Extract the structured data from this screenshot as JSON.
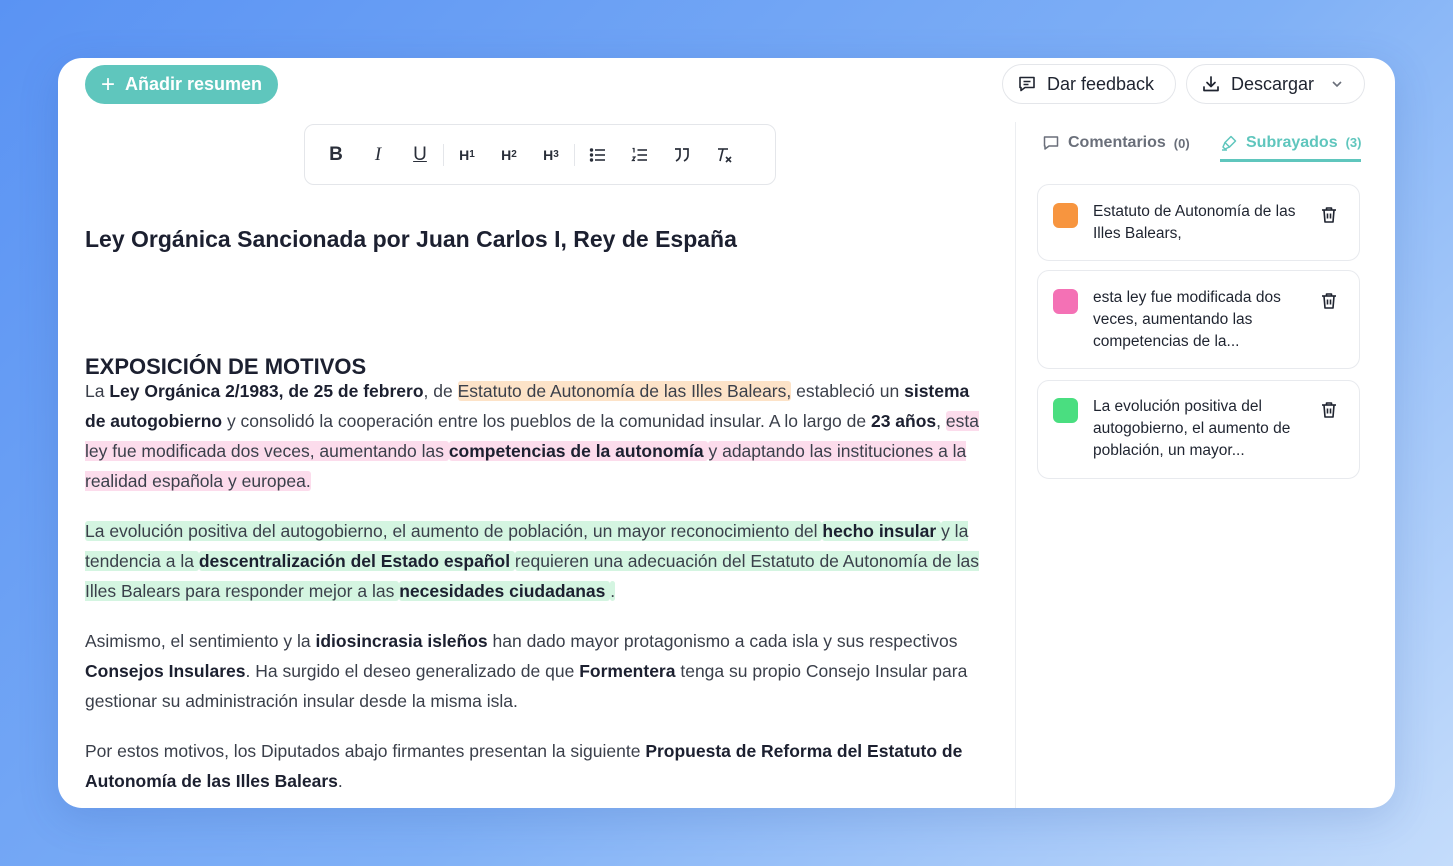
{
  "header": {
    "add_summary_label": "Añadir resumen",
    "feedback_label": "Dar feedback",
    "download_label": "Descargar"
  },
  "toolbar": {
    "bold": "B",
    "italic": "I",
    "underline": "U",
    "h1": "H",
    "h2": "H",
    "h3": "H",
    "h1_num": "1",
    "h2_num": "2",
    "h3_num": "3"
  },
  "document": {
    "title": "Ley Orgánica Sancionada por Juan Carlos I, Rey de España",
    "section_title": "EXPOSICIÓN DE MOTIVOS",
    "p1": {
      "t1": "La ",
      "b1": "Ley Orgánica 2/1983, de 25 de febrero",
      "t2": ", de ",
      "h1": "Estatuto de Autonomía de las Illes Balears,",
      "t3": " estableció un ",
      "b2": "sistema de autogobierno",
      "t4": " y consolidó la cooperación entre los pueblos de la comunidad insular. A lo largo de ",
      "b3": "23 años",
      "t5": ", ",
      "h2a": " esta ley fue modificada dos veces, aumentando las ",
      "h2b": " competencias de la autonomía ",
      "h2c": " y adaptando las instituciones a la realidad española y europea."
    },
    "p2": {
      "h1": " La evolución positiva del autogobierno, el aumento de población, un mayor reconocimiento del ",
      "b1": " hecho insular ",
      "h2": " y la tendencia a la ",
      "b2": " descentralización del Estado español ",
      "h3": " requieren una adecuación del Estatuto de Autonomía de las Illes Balears para responder mejor a las ",
      "b3": " necesidades ciudadanas ",
      "h4": "."
    },
    "p3": {
      "t1": "Asimismo, el sentimiento y la ",
      "b1": "idiosincrasia isleños",
      "t2": " han dado mayor protagonismo a cada isla y sus respectivos ",
      "b2": "Consejos Insulares",
      "t3": ". Ha surgido el deseo generalizado de que ",
      "b3": "Formentera",
      "t4": " tenga su propio Consejo Insular para gestionar su administración insular desde la misma isla."
    },
    "p4": {
      "t1": "Por estos motivos, los Diputados abajo firmantes presentan la siguiente ",
      "b1": "Propuesta de Reforma del Estatuto de Autonomía de las Illes Balears",
      "t2": "."
    }
  },
  "sidebar": {
    "tabs": [
      {
        "label": "Comentarios",
        "count": "(0)"
      },
      {
        "label": "Subrayados",
        "count": "(3)"
      }
    ],
    "highlights": [
      {
        "text": "Estatuto de Autonomía de las Illes Balears,",
        "color": "#f7953f"
      },
      {
        "text": "esta ley fue modificada dos veces, aumentando las competencias de la...",
        "color": "#f471b5"
      },
      {
        "text": "La evolución positiva del autogobierno, el aumento de población, un mayor...",
        "color": "#4ade80"
      }
    ]
  },
  "colors": {
    "accent": "#5fc6bd"
  }
}
